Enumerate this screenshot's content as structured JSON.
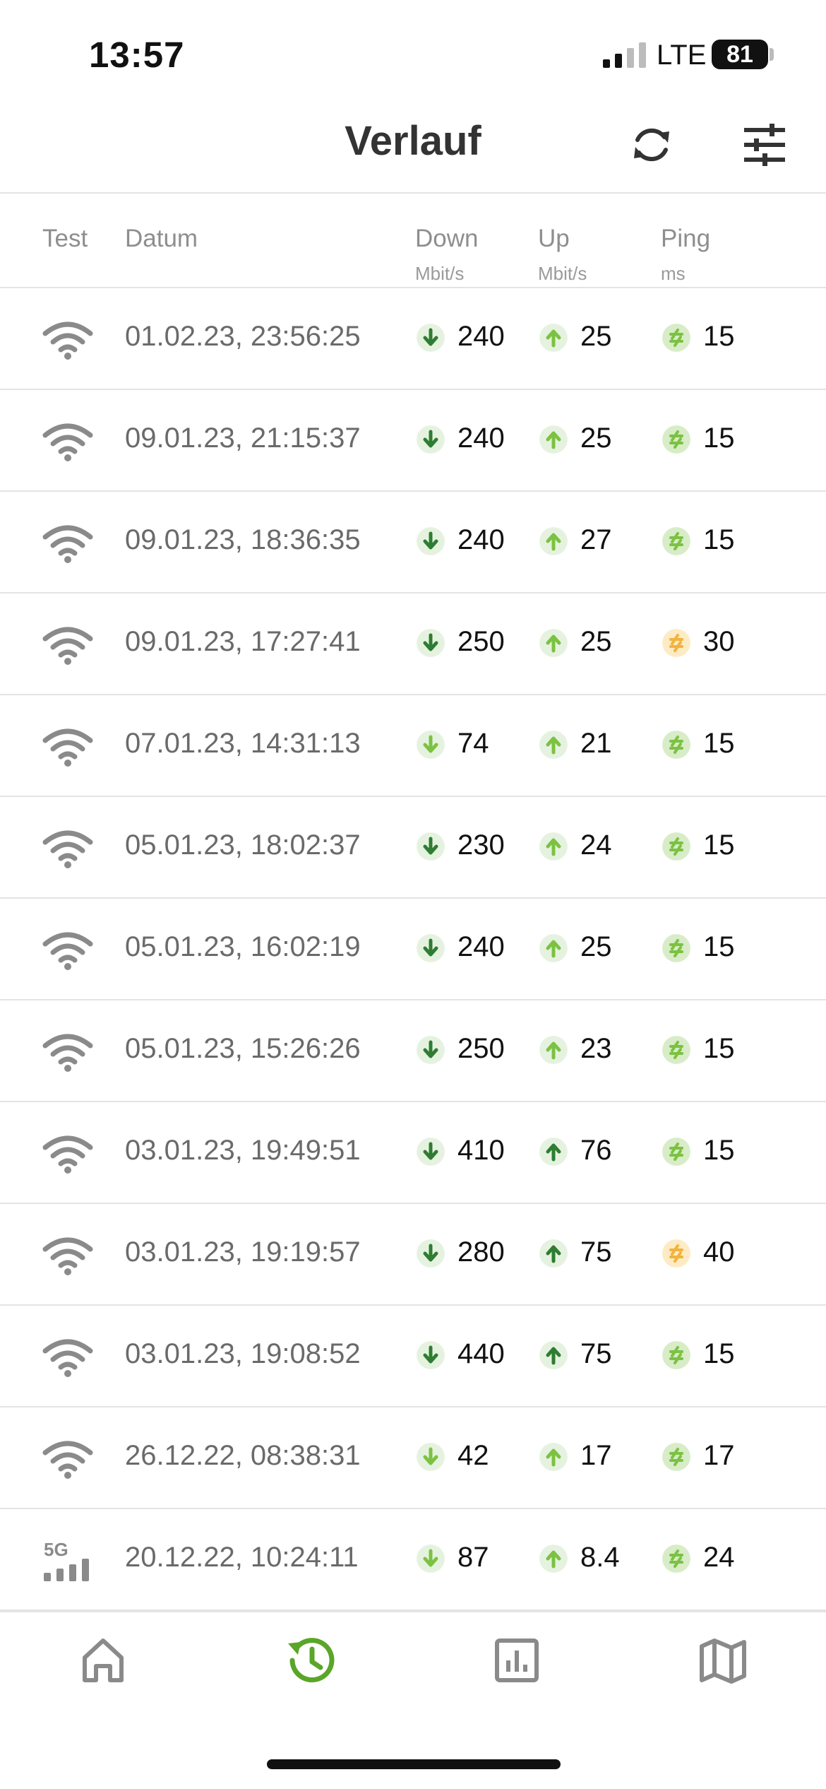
{
  "status_bar": {
    "time": "13:57",
    "network": "LTE",
    "battery": "81"
  },
  "header": {
    "title": "Verlauf",
    "refresh_icon": "refresh-icon",
    "filter_icon": "sliders-icon"
  },
  "columns": {
    "test": "Test",
    "date": "Datum",
    "down": "Down",
    "down_unit": "Mbit/s",
    "up": "Up",
    "up_unit": "Mbit/s",
    "ping": "Ping",
    "ping_unit": "ms"
  },
  "colors": {
    "green_dark": "#2e7d32",
    "green_light": "#7cc242",
    "badge_bg": "#e6f2e0",
    "ping_yellow": "#f2b33d",
    "ping_yellow_bg": "#fdebc4",
    "accent": "#5aa629",
    "icon_gray": "#8a8a8a"
  },
  "rows": [
    {
      "type": "wifi",
      "date": "01.02.23, 23:56:25",
      "down": "240",
      "up": "25",
      "ping": "15",
      "down_level": "dark",
      "up_level": "light",
      "ping_level": "good"
    },
    {
      "type": "wifi",
      "date": "09.01.23, 21:15:37",
      "down": "240",
      "up": "25",
      "ping": "15",
      "down_level": "dark",
      "up_level": "light",
      "ping_level": "good"
    },
    {
      "type": "wifi",
      "date": "09.01.23, 18:36:35",
      "down": "240",
      "up": "27",
      "ping": "15",
      "down_level": "dark",
      "up_level": "light",
      "ping_level": "good"
    },
    {
      "type": "wifi",
      "date": "09.01.23, 17:27:41",
      "down": "250",
      "up": "25",
      "ping": "30",
      "down_level": "dark",
      "up_level": "light",
      "ping_level": "medium"
    },
    {
      "type": "wifi",
      "date": "07.01.23, 14:31:13",
      "down": "74",
      "up": "21",
      "ping": "15",
      "down_level": "light",
      "up_level": "light",
      "ping_level": "good"
    },
    {
      "type": "wifi",
      "date": "05.01.23, 18:02:37",
      "down": "230",
      "up": "24",
      "ping": "15",
      "down_level": "dark",
      "up_level": "light",
      "ping_level": "good"
    },
    {
      "type": "wifi",
      "date": "05.01.23, 16:02:19",
      "down": "240",
      "up": "25",
      "ping": "15",
      "down_level": "dark",
      "up_level": "light",
      "ping_level": "good"
    },
    {
      "type": "wifi",
      "date": "05.01.23, 15:26:26",
      "down": "250",
      "up": "23",
      "ping": "15",
      "down_level": "dark",
      "up_level": "light",
      "ping_level": "good"
    },
    {
      "type": "wifi",
      "date": "03.01.23, 19:49:51",
      "down": "410",
      "up": "76",
      "ping": "15",
      "down_level": "dark",
      "up_level": "dark",
      "ping_level": "good"
    },
    {
      "type": "wifi",
      "date": "03.01.23, 19:19:57",
      "down": "280",
      "up": "75",
      "ping": "40",
      "down_level": "dark",
      "up_level": "dark",
      "ping_level": "medium"
    },
    {
      "type": "wifi",
      "date": "03.01.23, 19:08:52",
      "down": "440",
      "up": "75",
      "ping": "15",
      "down_level": "dark",
      "up_level": "dark",
      "ping_level": "good"
    },
    {
      "type": "wifi",
      "date": "26.12.22, 08:38:31",
      "down": "42",
      "up": "17",
      "ping": "17",
      "down_level": "light",
      "up_level": "light",
      "ping_level": "good"
    },
    {
      "type": "5g",
      "date": "20.12.22, 10:24:11",
      "down": "87",
      "up": "8.4",
      "ping": "24",
      "down_level": "light",
      "up_level": "light",
      "ping_level": "good"
    }
  ],
  "tabbar": {
    "tabs": [
      "home-icon",
      "history-icon",
      "statistics-icon",
      "map-icon"
    ],
    "active": "history-icon"
  }
}
